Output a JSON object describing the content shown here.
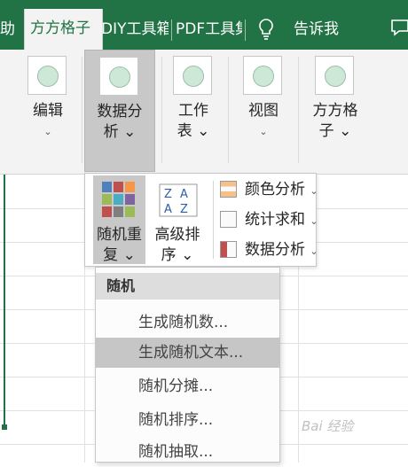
{
  "tabs": [
    "助",
    "方方格子",
    "DIY工具箱",
    "PDF工具集",
    "告诉我"
  ],
  "ribbon": {
    "buttons": [
      {
        "line1": "编辑",
        "line2": "⌄"
      },
      {
        "line1": "数据分",
        "line2": "析 ⌄"
      },
      {
        "line1": "工作",
        "line2": "表 ⌄"
      },
      {
        "line1": "视图",
        "line2": "⌄"
      },
      {
        "line1": "方方格",
        "line2": "子 ⌄"
      }
    ]
  },
  "panel": {
    "random": {
      "line1": "随机重",
      "line2": "复 ⌄"
    },
    "sort": {
      "line1": "高级排",
      "line2": "序 ⌄"
    },
    "small_items": [
      {
        "label": "颜色分析",
        "chevron": "⌄"
      },
      {
        "label": "统计求和",
        "chevron": "⌄"
      },
      {
        "label": "数据分析",
        "chevron": "⌄"
      }
    ]
  },
  "menu": {
    "header": "随机",
    "items": [
      "生成随机数...",
      "生成随机文本...",
      "随机分摊...",
      "随机排序...",
      "随机抽取..."
    ]
  },
  "watermark": "Bai 经验",
  "colors": {
    "accent": "#217346",
    "hover": "#c6c6c6"
  }
}
